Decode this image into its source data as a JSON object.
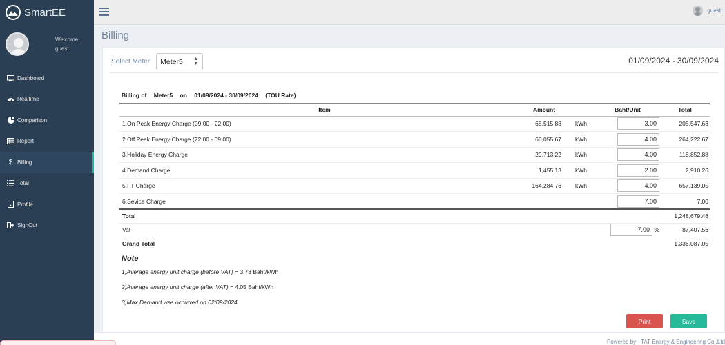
{
  "brand": {
    "name": "SmartEE"
  },
  "profile": {
    "welcome": "Welcome,",
    "username": "guest"
  },
  "topbar": {
    "username": "guest"
  },
  "sidebar": {
    "items": [
      {
        "label": "Dashboard",
        "icon": "monitor-icon"
      },
      {
        "label": "Realtime",
        "icon": "dashboard-gauge-icon"
      },
      {
        "label": "Comparison",
        "icon": "pie-chart-icon"
      },
      {
        "label": "Report",
        "icon": "table-icon"
      },
      {
        "label": "Billing",
        "icon": "dollar-icon",
        "active": true
      },
      {
        "label": "Total",
        "icon": "list-icon"
      },
      {
        "label": "Profile",
        "icon": "file-icon"
      },
      {
        "label": "SignOut",
        "icon": "sign-out-icon"
      }
    ]
  },
  "page": {
    "title": "Billing"
  },
  "meter": {
    "label": "Select Meter",
    "selected": "Meter5"
  },
  "date_range": "01/09/2024 - 30/09/2024",
  "bill": {
    "heading": {
      "prefix": "Billing of",
      "meter": "Meter5",
      "on": "on",
      "range": "01/09/2024 - 30/09/2024",
      "rate": "(TOU Rate)"
    },
    "columns": {
      "item": "Item",
      "amount": "Amount",
      "rate": "Baht/Unit",
      "total": "Total"
    },
    "rows": [
      {
        "item": "1.On Peak Energy Charge  (09:00 - 22:00)",
        "amount": "68,515.88",
        "unit": "kWh",
        "rate": "3.00",
        "total": "205,547.63"
      },
      {
        "item": "2.Off Peak Energy Charge  (22:00 - 09:00)",
        "amount": "66,055.67",
        "unit": "kWh",
        "rate": "4.00",
        "total": "264,222.67"
      },
      {
        "item": "3.Holiday Energy Charge",
        "amount": "29,713.22",
        "unit": "kWh",
        "rate": "4.00",
        "total": "118,852.88"
      },
      {
        "item": "4.Demand Charge",
        "amount": "1,455.13",
        "unit": "kWh",
        "rate": "2.00",
        "total": "2,910.26"
      },
      {
        "item": "5.FT Charge",
        "amount": "164,284.76",
        "unit": "kWh",
        "rate": "4.00",
        "total": "657,139.05"
      },
      {
        "item": "6.Sevice Charge",
        "amount": "",
        "unit": "",
        "rate": "7.00",
        "total": "7.00"
      }
    ],
    "total": {
      "label": "Total",
      "value": "1,248,679.48"
    },
    "vat": {
      "label": "Vat",
      "rate": "7.00",
      "unit": "%",
      "value": "87,407.56"
    },
    "grand_total": {
      "label": "Grand Total",
      "value": "1,336,087.05"
    }
  },
  "notes": {
    "title": "Note",
    "lines": [
      {
        "text": "1)Average energy unit charge (before VAT) =",
        "value": " 3.78  Baht/kWh"
      },
      {
        "text": "2)Average energy unit charge (after VAT) =",
        "value": " 4.05  Baht/kWh"
      },
      {
        "text": "3)Max Demand was occurred on 02/09/2024",
        "value": ""
      }
    ]
  },
  "buttons": {
    "print": "Print",
    "save": "Save"
  },
  "footer": {
    "text": "Powered by - TAT Energy & Engineering Co.,Ltd"
  }
}
